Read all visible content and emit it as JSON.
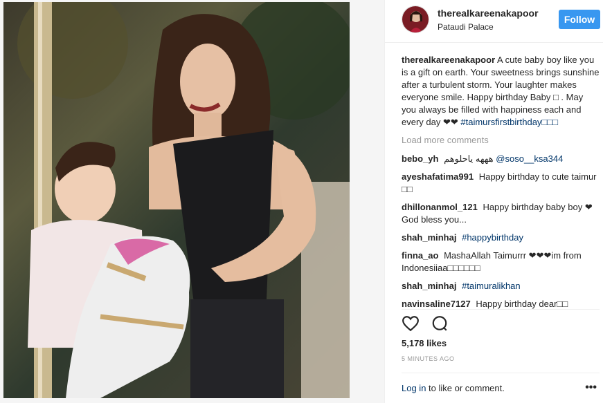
{
  "post": {
    "username": "therealkareenakapoor",
    "location": "Pataudi Palace",
    "follow_label": "Follow",
    "caption_user": "therealkareenakapoor",
    "caption_text": "A cute baby boy like you is a gift on earth. Your sweetness brings sunshine after a turbulent storm. Your laughter makes everyone smile. Happy birthday Baby □ . May you always be filled with happiness each and every day ❤❤",
    "caption_hashtag": "#taimursfirstbirthday□□□",
    "load_more": "Load more comments",
    "likes": "5,178 likes",
    "time": "5 MINUTES AGO",
    "login_link": "Log in",
    "login_rest": " to like or comment.",
    "more_label": "•••"
  },
  "comments": [
    {
      "user": "bebo_yh",
      "text": "هههه ياحلوهم",
      "mention": "@soso__ksa344"
    },
    {
      "user": "ayeshafatima991",
      "text": "Happy birthday to cute taimur □□",
      "mention": ""
    },
    {
      "user": "dhillonanmol_121",
      "text": "Happy birthday baby boy ❤God bless you...",
      "mention": ""
    },
    {
      "user": "shah_minhaj",
      "text": "",
      "mention": "#happybirthday"
    },
    {
      "user": "finna_ao",
      "text": "MashaAllah Taimurrr ❤❤❤im from Indonesiiaa□□□□□□",
      "mention": ""
    },
    {
      "user": "shah_minhaj",
      "text": "",
      "mention": "#taimuralikhan"
    },
    {
      "user": "navinsaline7127",
      "text": "Happy birthday dear□□",
      "mention": ""
    }
  ],
  "colors": {
    "follow_bg": "#3897f0",
    "link": "#003569",
    "muted": "#999999"
  },
  "icons": [
    "heart-icon",
    "comment-icon",
    "more-options-icon"
  ]
}
